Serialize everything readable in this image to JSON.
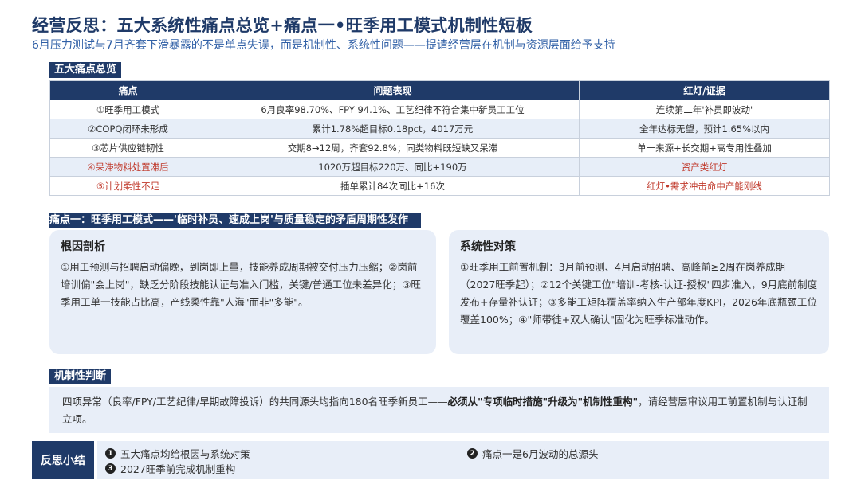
{
  "header": {
    "title": "经营反思：五大系统性痛点总览+痛点一•旺季用工模式机制性短板",
    "subtitle": "6月压力测试与7月齐套下滑暴露的不是单点失误，而是机制性、系统性问题——提请经营层在机制与资源层面给予支持"
  },
  "overview": {
    "tag": "五大痛点总览",
    "columns": [
      "痛点",
      "问题表现",
      "红灯/证据"
    ],
    "rows": [
      {
        "pain": "①旺季用工模式",
        "issue": "6月良率98.70%、FPY 94.1%、工艺纪律不符合集中新员工工位",
        "evidence": "连续第二年'补员即波动'",
        "red": false
      },
      {
        "pain": "②COPQ闭环未形成",
        "issue": "累计1.78%超目标0.18pct，4017万元",
        "evidence": "全年达标无望，预计1.65%以内",
        "red": false
      },
      {
        "pain": "③芯片供应链韧性",
        "issue": "交期8→12周，齐套92.8%；同类物料既短缺又呆滞",
        "evidence": "单一来源+长交期+高专用性叠加",
        "red": false
      },
      {
        "pain": "④呆滞物料处置滞后",
        "issue": "1020万超目标220万、同比+190万",
        "evidence": "资产类红灯",
        "red": true
      },
      {
        "pain": "⑤计划柔性不足",
        "issue": "插单累计84次同比+16次",
        "evidence": "红灯•需求冲击命中产能刚线",
        "red": true
      }
    ]
  },
  "pain1": {
    "banner": "痛点一：旺季用工模式——'临时补员、速成上岗'与质量稳定的矛盾周期性发作",
    "root": {
      "heading": "根因剖析",
      "body": "①用工预测与招聘启动偏晚，到岗即上量，技能养成周期被交付压力压缩；②岗前培训偏\"会上岗\"，缺乏分阶段技能认证与准入门槛，关键/普通工位未差异化；③旺季用工单一技能占比高，产线柔性靠\"人海\"而非\"多能\"。"
    },
    "measures": {
      "heading": "系统性对策",
      "body": "①旺季用工前置机制：3月前预测、4月启动招聘、高峰前≥2周在岗养成期（2027旺季起）；②12个关键工位\"培训-考核-认证-授权\"四步准入，9月底前制度发布+存量补认证；③多能工矩阵覆盖率纳入生产部年度KPI，2026年底瓶颈工位覆盖100%；④\"师带徒+双人确认\"固化为旺季标准动作。"
    }
  },
  "judgement": {
    "tag": "机制性判断",
    "text_a": "四项异常（良率/FPY/工艺纪律/早期故障投诉）的共同源头均指向180名旺季新员工——",
    "text_b": "必须从\"专项临时措施\"升级为\"机制性重构\"",
    "text_c": "，请经营层审议用工前置机制与认证制立项。"
  },
  "summary": {
    "label": "反思小结",
    "items": [
      {
        "num": "1",
        "text": "五大痛点均给根因与系统对策"
      },
      {
        "num": "2",
        "text": "痛点一是6月波动的总源头"
      },
      {
        "num": "3",
        "text": "2027旺季前完成机制重构"
      }
    ]
  },
  "colors": {
    "primary": "#1f3a68",
    "accent": "#2f5fa6",
    "panel_bg": "#e8eef8",
    "red": "#c0392b"
  }
}
